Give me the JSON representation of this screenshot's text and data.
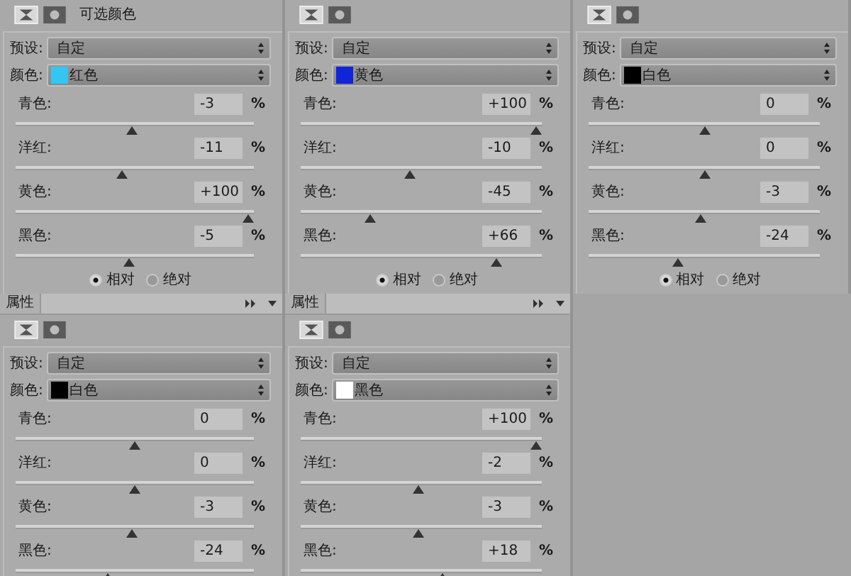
{
  "top_panels": [
    {
      "title": "可选颜色",
      "preset_label": "预设:",
      "preset": "自定",
      "color_label": "颜色:",
      "color_name": "红色",
      "color": "#33c6f2",
      "sliders": [
        {
          "label": "青色:",
          "value": "-3",
          "unit": "%",
          "level": 0.485
        },
        {
          "label": "洋红:",
          "value": "-11",
          "unit": "%",
          "level": 0.445
        },
        {
          "label": "黄色:",
          "value": "+100",
          "unit": "%",
          "level": 1
        },
        {
          "label": "黑色:",
          "value": "-5",
          "unit": "%",
          "level": 0.475
        }
      ],
      "method": [
        {
          "label": "相对",
          "selected": true
        },
        {
          "label": "绝对",
          "selected": false
        }
      ]
    },
    {
      "preset_label": "预设:",
      "preset": "自定",
      "color_label": "颜色:",
      "color_name": "黄色",
      "color": "#1024d8",
      "sliders": [
        {
          "label": "青色:",
          "value": "+100",
          "unit": "%",
          "level": 1
        },
        {
          "label": "洋红:",
          "value": "-10",
          "unit": "%",
          "level": 0.45
        },
        {
          "label": "黄色:",
          "value": "-45",
          "unit": "%",
          "level": 0.275
        },
        {
          "label": "黑色:",
          "value": "+66",
          "unit": "%",
          "level": 0.83
        }
      ],
      "method": [
        {
          "label": "相对",
          "selected": true
        },
        {
          "label": "绝对",
          "selected": false
        }
      ]
    },
    {
      "preset_label": "预设:",
      "preset": "自定",
      "color_label": "颜色:",
      "color_name": "白色",
      "color": "#000000",
      "sliders": [
        {
          "label": "青色:",
          "value": "0",
          "unit": "%",
          "level": 0.5
        },
        {
          "label": "洋红:",
          "value": "0",
          "unit": "%",
          "level": 0.5
        },
        {
          "label": "黄色:",
          "value": "-3",
          "unit": "%",
          "level": 0.485
        },
        {
          "label": "黑色:",
          "value": "-24",
          "unit": "%",
          "level": 0.38
        }
      ],
      "method": [
        {
          "label": "相对",
          "selected": true
        },
        {
          "label": "绝对",
          "selected": false
        }
      ]
    }
  ],
  "bottom_panels": [
    {
      "tab": "属性",
      "preset_label": "预设:",
      "preset": "自定",
      "color_label": "颜色:",
      "color_name": "白色",
      "color": "#000000",
      "sliders": [
        {
          "label": "青色:",
          "value": "0",
          "unit": "%",
          "level": 0.5
        },
        {
          "label": "洋红:",
          "value": "0",
          "unit": "%",
          "level": 0.5
        },
        {
          "label": "黄色:",
          "value": "-3",
          "unit": "%",
          "level": 0.485
        },
        {
          "label": "黑色:",
          "value": "-24",
          "unit": "%",
          "level": 0.38
        }
      ]
    },
    {
      "tab": "属性",
      "preset_label": "预设:",
      "preset": "自定",
      "color_label": "颜色:",
      "color_name": "黑色",
      "color": "#ffffff",
      "sliders": [
        {
          "label": "青色:",
          "value": "+100",
          "unit": "%",
          "level": 1
        },
        {
          "label": "洋红:",
          "value": "-2",
          "unit": "%",
          "level": 0.49
        },
        {
          "label": "黄色:",
          "value": "-3",
          "unit": "%",
          "level": 0.485
        },
        {
          "label": "黑色:",
          "value": "+18",
          "unit": "%",
          "level": 0.59
        }
      ]
    }
  ]
}
